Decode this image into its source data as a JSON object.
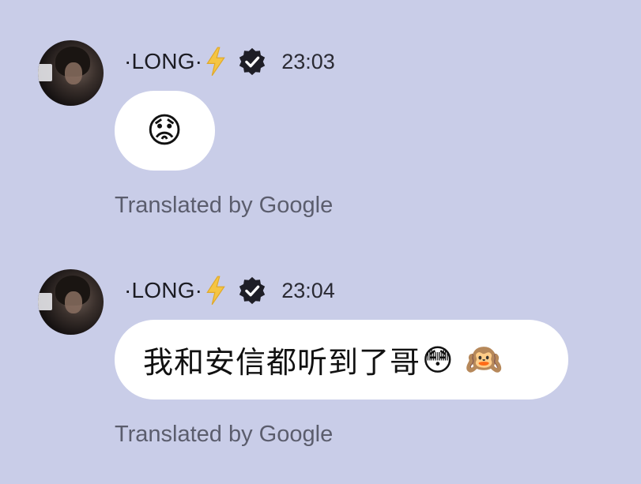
{
  "messages": [
    {
      "sender": "·LONG·",
      "time": "23:03",
      "emoji_text": "😟",
      "text": "",
      "trailing_emoji": [],
      "translated_label": "Translated by Google"
    },
    {
      "sender": "·LONG·",
      "time": "23:04",
      "emoji_text": "",
      "text": "我和安信都听到了哥",
      "trailing_emoji": [
        "😳",
        "🙉"
      ],
      "translated_label": "Translated by Google"
    }
  ],
  "icons": {
    "lightning": "lightning-bolt-icon",
    "verified": "verified-badge-icon"
  },
  "colors": {
    "background": "#c9cde8",
    "bubble": "#ffffff",
    "bolt": "#f5c542",
    "badge": "#1e1e26",
    "muted_text": "#5b5d6d"
  }
}
